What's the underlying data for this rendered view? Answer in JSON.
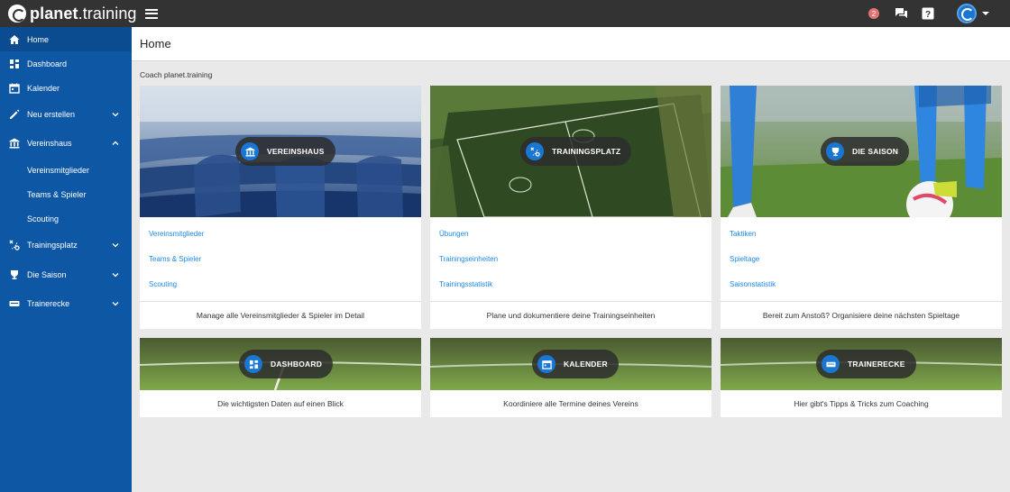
{
  "topbar": {
    "brand_bold": "planet",
    "brand_rest": ".training",
    "notification_count": "2"
  },
  "sidebar": {
    "items": [
      {
        "label": "Home",
        "icon": "home-icon"
      },
      {
        "label": "Dashboard",
        "icon": "dashboard-icon"
      },
      {
        "label": "Kalender",
        "icon": "calendar-icon"
      },
      {
        "label": "Neu erstellen",
        "icon": "pencil-icon"
      },
      {
        "label": "Vereinshaus",
        "icon": "bank-icon"
      },
      {
        "label": "Vereinsmitglieder"
      },
      {
        "label": "Teams & Spieler"
      },
      {
        "label": "Scouting"
      },
      {
        "label": "Trainingsplatz",
        "icon": "tactics-icon"
      },
      {
        "label": "Die Saison",
        "icon": "trophy-icon"
      },
      {
        "label": "Trainerecke",
        "icon": "whistle-icon"
      }
    ]
  },
  "header": {
    "title": "Home"
  },
  "coach_label": "Coach planet.training",
  "cards": [
    {
      "title": "VEREINSHAUS",
      "links": [
        "Vereinsmitglieder",
        "Teams & Spieler",
        "Scouting"
      ],
      "footer": "Manage alle Vereinsmitglieder & Spieler im Detail"
    },
    {
      "title": "TRAININGSPLATZ",
      "links": [
        "Übungen",
        "Trainingseinheiten",
        "Trainingsstatistik"
      ],
      "footer": "Plane und dokumentiere deine Trainingseinheiten"
    },
    {
      "title": "DIE SAISON",
      "links": [
        "Taktiken",
        "Spieltage",
        "Saisonstatistik"
      ],
      "footer": "Bereit zum Anstoß? Organisiere deine nächsten Spieltage"
    },
    {
      "title": "DASHBOARD",
      "footer": "Die wichtigsten Daten auf einen Blick"
    },
    {
      "title": "KALENDER",
      "footer": "Koordiniere alle Termine deines Vereins"
    },
    {
      "title": "TRAINERECKE",
      "footer": "Hier gibt's Tipps & Tricks zum Coaching"
    }
  ],
  "colors": {
    "sidebar": "#0d57a5",
    "topbar": "#333333",
    "accent": "#1976d2",
    "link": "#1e88e5",
    "badge": "#e57373"
  }
}
